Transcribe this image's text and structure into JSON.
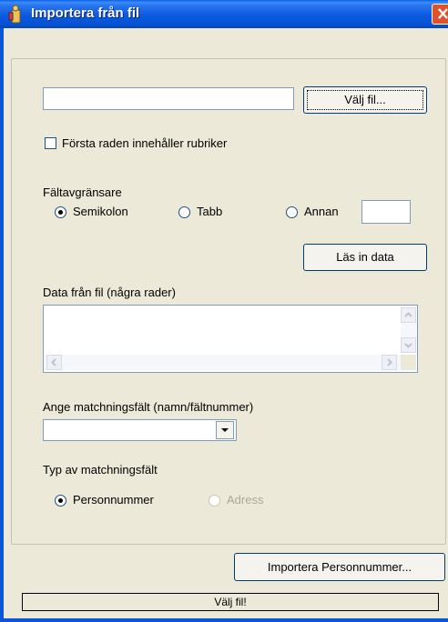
{
  "window": {
    "title": "Importera från fil",
    "colors": {
      "titlebar": "#0a5adf",
      "close_button": "#e0512c",
      "face": "#ece9d8"
    }
  },
  "file": {
    "path_value": "",
    "browse_button": "Välj fil..."
  },
  "first_row_headers": {
    "label": "Första raden innehåller rubriker",
    "checked": false
  },
  "delimiter": {
    "group_label": "Fältavgränsare",
    "options": [
      {
        "label": "Semikolon",
        "selected": true
      },
      {
        "label": "Tabb",
        "selected": false
      },
      {
        "label": "Annan",
        "selected": false
      }
    ],
    "other_value": ""
  },
  "load_button": "Läs in data",
  "preview": {
    "label": "Data från fil (några rader)",
    "content": ""
  },
  "match_field": {
    "label": "Ange matchningsfält (namn/fältnummer)",
    "selected": ""
  },
  "match_type": {
    "label": "Typ av matchningsfält",
    "options": [
      {
        "label": "Personnummer",
        "selected": true,
        "enabled": true
      },
      {
        "label": "Adress",
        "selected": false,
        "enabled": false
      }
    ]
  },
  "import_button": "Importera Personnummer...",
  "status": "Välj fil!"
}
